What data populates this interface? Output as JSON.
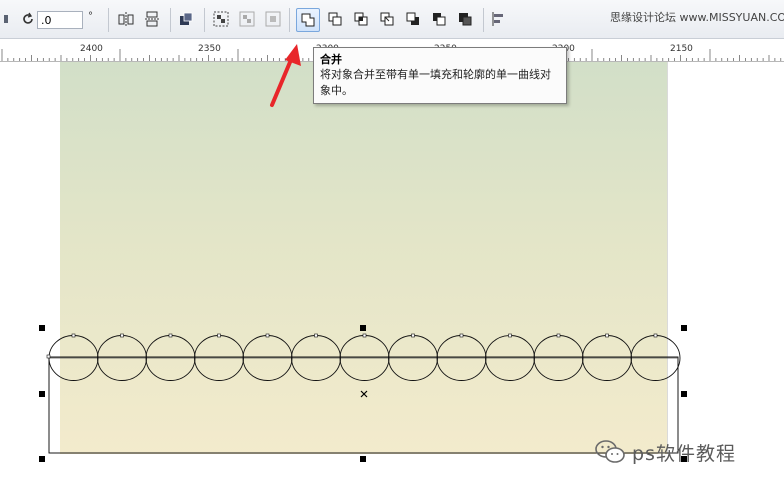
{
  "toolbar": {
    "rotation_value": ".0",
    "rotation_unit": "°",
    "buttons": [
      "mirror-horizontal",
      "mirror-vertical",
      "convert-to-curves",
      "group",
      "ungroup",
      "ungroup-all",
      "weld",
      "trim",
      "intersect",
      "simplify",
      "front-minus-back",
      "back-minus-front",
      "boundary",
      "align-distribute"
    ]
  },
  "watermark_top": "思缘设计论坛 www.MISSYUAN.COM",
  "ruler": {
    "labels": [
      "2400",
      "2350",
      "2300",
      "2250",
      "2200",
      "2150"
    ]
  },
  "tooltip": {
    "title": "合并",
    "description": "将对象合并至带有单一填充和轮廓的单一曲线对象中。"
  },
  "canvas": {
    "circle_count": 13
  },
  "watermark_bottom": "ps软件教程",
  "colors": {
    "arrow": "#e8262a",
    "page_top": "#d2dfc8",
    "page_bottom": "#f3ebcc"
  }
}
